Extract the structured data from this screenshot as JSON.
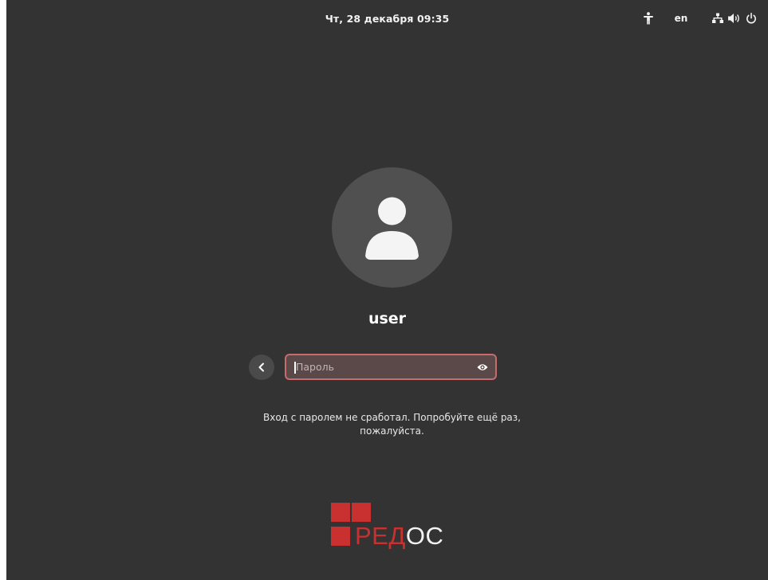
{
  "top_bar": {
    "clock": "Чт, 28 декабря  09:35",
    "keyboard_layout": "en",
    "icons": [
      "accessibility-icon",
      "network-wired-icon",
      "volume-icon",
      "power-icon"
    ]
  },
  "login": {
    "username": "user",
    "password_placeholder": "Пароль",
    "error_message": "Вход с паролем не сработал. Попробуйте ещё раз, пожалуйста."
  },
  "logo": {
    "text_red": "РЕД",
    "text_white": "ОС"
  },
  "colors": {
    "background": "#333333",
    "avatar_bg": "#505050",
    "field_error_border": "#c66c6c",
    "field_bg": "#5b4848",
    "brand_red": "#c93030"
  }
}
